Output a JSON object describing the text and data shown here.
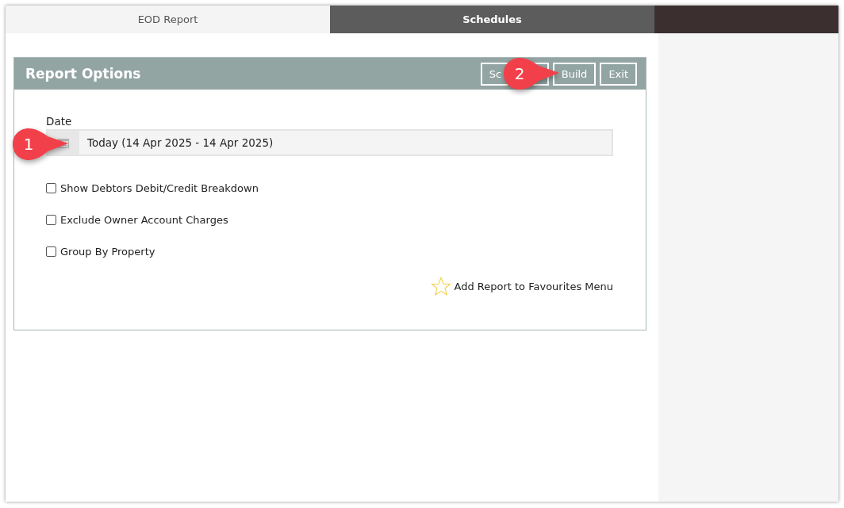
{
  "tabs": [
    {
      "label": "EOD Report",
      "selected": true
    },
    {
      "label": "Schedules",
      "selected": false
    }
  ],
  "panel": {
    "title": "Report Options",
    "buttons": [
      "Sc",
      "Build",
      "Exit"
    ]
  },
  "date": {
    "label": "Date",
    "value": "Today (14 Apr 2025 - 14 Apr 2025)"
  },
  "options": [
    {
      "label": "Show Debtors Debit/Credit Breakdown",
      "checked": false
    },
    {
      "label": "Exclude Owner Account Charges",
      "checked": false
    },
    {
      "label": "Group By Property",
      "checked": false
    }
  ],
  "favourites": {
    "label": "Add Report to Favourites Menu"
  },
  "callouts": [
    {
      "number": "1"
    },
    {
      "number": "2"
    }
  ]
}
